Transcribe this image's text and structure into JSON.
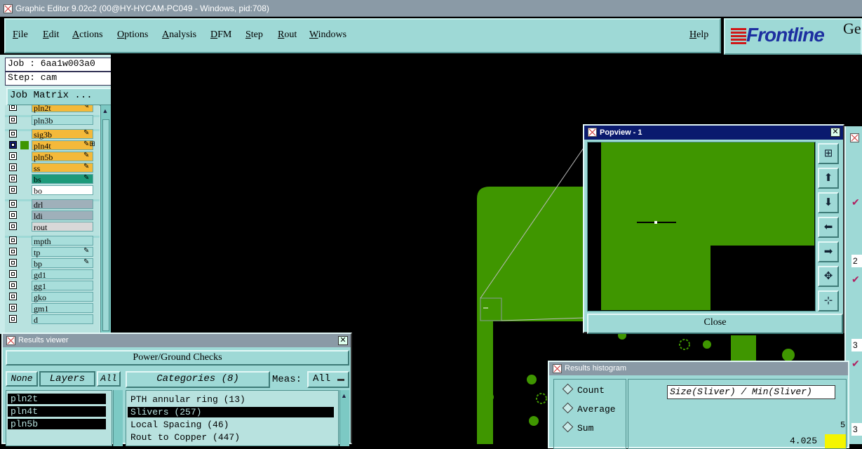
{
  "window": {
    "title": "Graphic Editor 9.02c2 (00@HY-HYCAM-PC049 - Windows, pid:708)"
  },
  "menu": {
    "items": [
      "File",
      "Edit",
      "Actions",
      "Options",
      "Analysis",
      "DFM",
      "Step",
      "Rout",
      "Windows"
    ],
    "help": "Help"
  },
  "brand": {
    "name": "Frontline",
    "suffix": "Ge"
  },
  "job": {
    "job_label": "Job : 6aa1w003a0",
    "step_label": "Step: cam",
    "matrix_button": "Job Matrix ..."
  },
  "layers": [
    {
      "name": "pln2t",
      "color": "#f4b93a",
      "mark": "✎"
    },
    {
      "name": "pln3b",
      "color": "#a8dedb",
      "mark": ""
    },
    {
      "name": "sig3b",
      "color": "#f4b93a",
      "mark": "✎"
    },
    {
      "name": "pln4t",
      "color": "#f4b93a",
      "mark": "✎⊞",
      "selected": true
    },
    {
      "name": "pln5b",
      "color": "#f4b93a",
      "mark": "✎"
    },
    {
      "name": "ss",
      "color": "#f4b93a",
      "mark": "✎"
    },
    {
      "name": "bs",
      "color": "#1d9a7a",
      "mark": "✎"
    },
    {
      "name": "bo",
      "color": "#ffffff",
      "mark": ""
    },
    {
      "name": "drl",
      "color": "#9fb0ba",
      "mark": ""
    },
    {
      "name": "ldi",
      "color": "#9fb0ba",
      "mark": ""
    },
    {
      "name": "rout",
      "color": "#d8d8d8",
      "mark": ""
    },
    {
      "name": "mpth",
      "color": "#a8dedb",
      "mark": ""
    },
    {
      "name": "tp",
      "color": "#a8dedb",
      "mark": "✎"
    },
    {
      "name": "bp",
      "color": "#a8dedb",
      "mark": "✎"
    },
    {
      "name": "gd1",
      "color": "#a8dedb",
      "mark": ""
    },
    {
      "name": "gg1",
      "color": "#a8dedb",
      "mark": ""
    },
    {
      "name": "gko",
      "color": "#a8dedb",
      "mark": ""
    },
    {
      "name": "gm1",
      "color": "#a8dedb",
      "mark": ""
    },
    {
      "name": "d",
      "color": "#a8dedb",
      "mark": ""
    }
  ],
  "popview": {
    "title": "Popview - 1",
    "close_label": "Close",
    "close_x": "✕"
  },
  "results": {
    "title": "Results viewer",
    "header": "Power/Ground Checks",
    "none_label": "None",
    "layers_label": "Layers",
    "all_label": "All",
    "categories_label": "Categories (8)",
    "meas_label": "Meas:",
    "meas_value": "All",
    "layer_items": [
      "pln2t",
      "pln4t",
      "pln5b"
    ],
    "category_items": [
      "PTH annular ring (13)",
      "Slivers (257)",
      "Local Spacing (46)",
      "Rout to Copper (447)"
    ],
    "selected_category": 1
  },
  "histogram": {
    "title": "Results histogram",
    "options": [
      "Count",
      "Average",
      "Sum"
    ],
    "axis_label": "Size(Sliver) / Min(Sliver)",
    "value": "4.025",
    "edge_value": "5"
  },
  "right_strip_numbers": [
    "2",
    "3",
    "3"
  ]
}
